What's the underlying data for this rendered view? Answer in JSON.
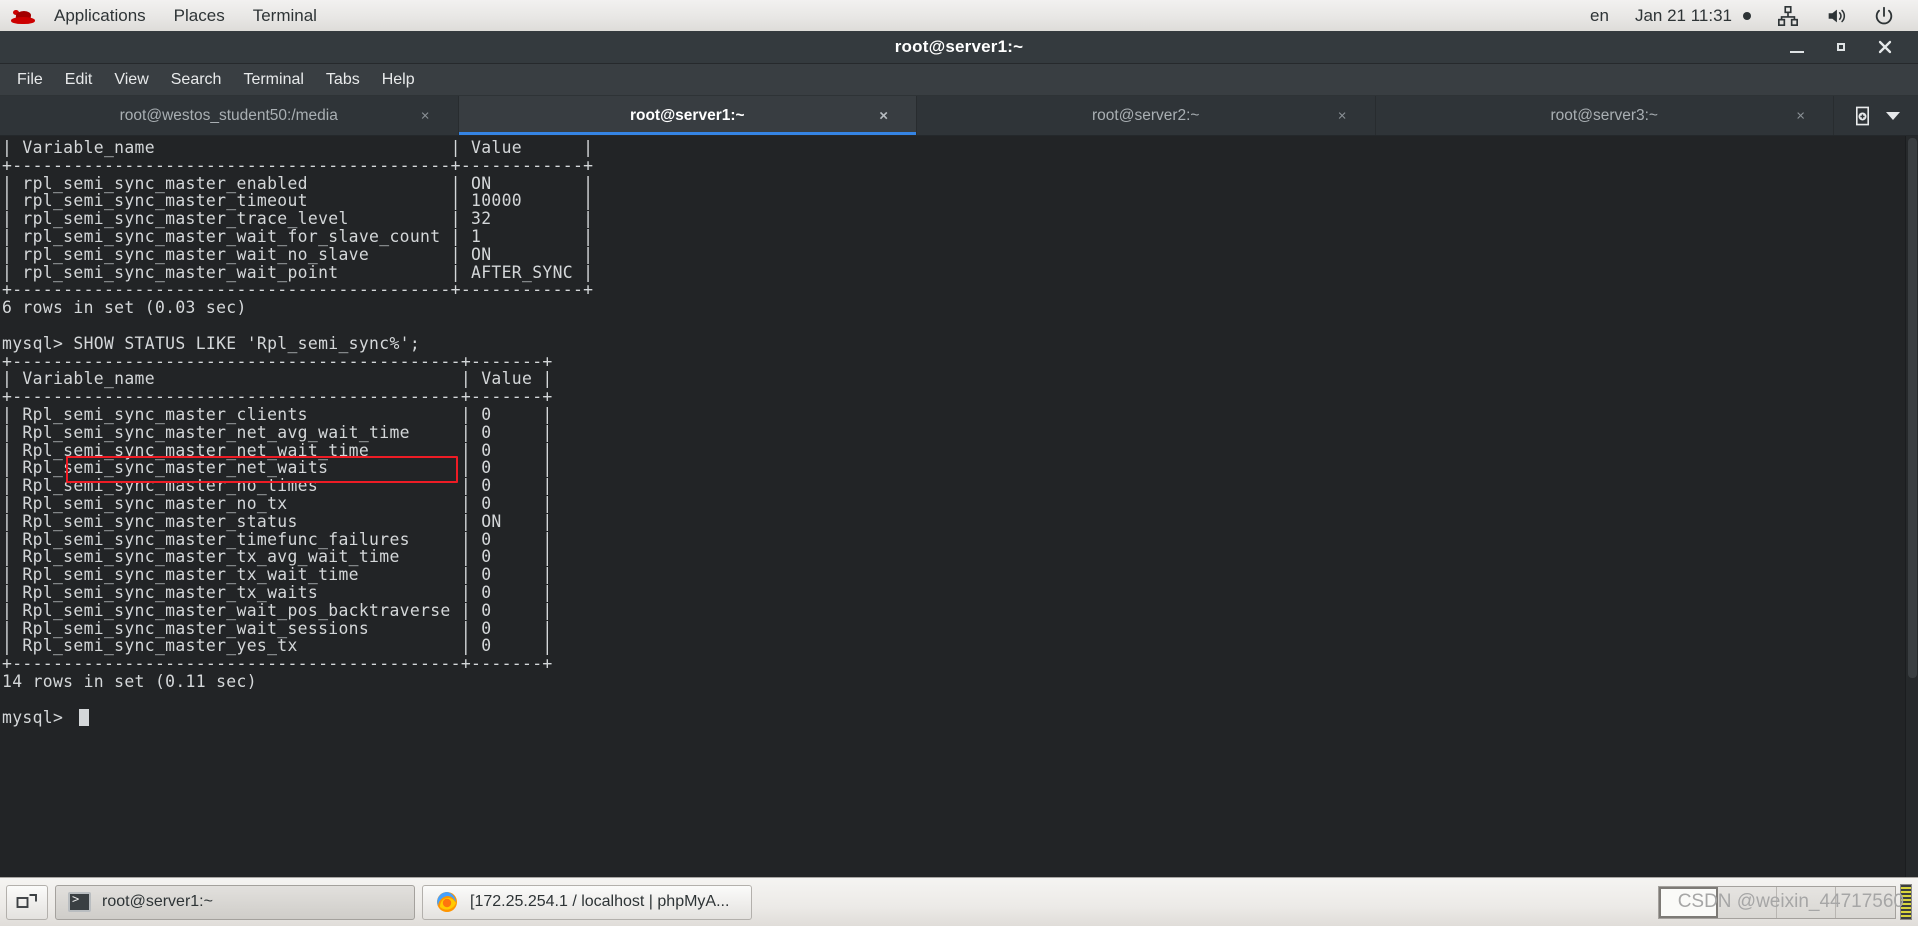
{
  "top_panel": {
    "logo": "redhat-logo",
    "menus": [
      "Applications",
      "Places",
      "Terminal"
    ],
    "language": "en",
    "clock": "Jan 21  11:31",
    "icons": [
      "network-icon",
      "volume-icon",
      "power-icon"
    ]
  },
  "window": {
    "title": "root@server1:~",
    "controls": {
      "minimize": "minimize-button",
      "maximize": "maximize-button",
      "close": "close-button"
    },
    "menu_bar": [
      "File",
      "Edit",
      "View",
      "Search",
      "Terminal",
      "Tabs",
      "Help"
    ],
    "tabs": [
      {
        "label": "root@westos_student50:/media",
        "active": false,
        "close": "×"
      },
      {
        "label": "root@server1:~",
        "active": true,
        "close": "×"
      },
      {
        "label": "root@server2:~",
        "active": false,
        "close": "×"
      },
      {
        "label": "root@server3:~",
        "active": false,
        "close": "×"
      }
    ],
    "tab_tools": {
      "new_tab": "new-tab-icon",
      "tab_menu": "chevron-down-icon"
    }
  },
  "terminal": {
    "prompt": "mysql>",
    "highlighted_command": "SHOW STATUS LIKE 'Rpl_semi_sync%';",
    "first_result_footer": "6 rows in set (0.03 sec)",
    "second_result_footer": "14 rows in set (0.11 sec)",
    "columns": [
      "Variable_name",
      "Value"
    ],
    "variables_table": [
      {
        "name": "rpl_semi_sync_master_enabled",
        "value": "ON"
      },
      {
        "name": "rpl_semi_sync_master_timeout",
        "value": "10000"
      },
      {
        "name": "rpl_semi_sync_master_trace_level",
        "value": "32"
      },
      {
        "name": "rpl_semi_sync_master_wait_for_slave_count",
        "value": "1"
      },
      {
        "name": "rpl_semi_sync_master_wait_no_slave",
        "value": "ON"
      },
      {
        "name": "rpl_semi_sync_master_wait_point",
        "value": "AFTER_SYNC"
      }
    ],
    "status_table": [
      {
        "name": "Rpl_semi_sync_master_clients",
        "value": "0"
      },
      {
        "name": "Rpl_semi_sync_master_net_avg_wait_time",
        "value": "0"
      },
      {
        "name": "Rpl_semi_sync_master_net_wait_time",
        "value": "0"
      },
      {
        "name": "Rpl_semi_sync_master_net_waits",
        "value": "0"
      },
      {
        "name": "Rpl_semi_sync_master_no_times",
        "value": "0"
      },
      {
        "name": "Rpl_semi_sync_master_no_tx",
        "value": "0"
      },
      {
        "name": "Rpl_semi_sync_master_status",
        "value": "ON"
      },
      {
        "name": "Rpl_semi_sync_master_timefunc_failures",
        "value": "0"
      },
      {
        "name": "Rpl_semi_sync_master_tx_avg_wait_time",
        "value": "0"
      },
      {
        "name": "Rpl_semi_sync_master_tx_wait_time",
        "value": "0"
      },
      {
        "name": "Rpl_semi_sync_master_tx_waits",
        "value": "0"
      },
      {
        "name": "Rpl_semi_sync_master_wait_pos_backtraverse",
        "value": "0"
      },
      {
        "name": "Rpl_semi_sync_master_wait_sessions",
        "value": "0"
      },
      {
        "name": "Rpl_semi_sync_master_yes_tx",
        "value": "0"
      }
    ],
    "screen_text": "| Variable_name                             | Value      |\n+-------------------------------------------+------------+\n| rpl_semi_sync_master_enabled              | ON         |\n| rpl_semi_sync_master_timeout              | 10000      |\n| rpl_semi_sync_master_trace_level          | 32         |\n| rpl_semi_sync_master_wait_for_slave_count | 1          |\n| rpl_semi_sync_master_wait_no_slave        | ON         |\n| rpl_semi_sync_master_wait_point           | AFTER_SYNC |\n+-------------------------------------------+------------+\n6 rows in set (0.03 sec)\n\nmysql> SHOW STATUS LIKE 'Rpl_semi_sync%';\n+--------------------------------------------+-------+\n| Variable_name                              | Value |\n+--------------------------------------------+-------+\n| Rpl_semi_sync_master_clients               | 0     |\n| Rpl_semi_sync_master_net_avg_wait_time     | 0     |\n| Rpl_semi_sync_master_net_wait_time         | 0     |\n| Rpl_semi_sync_master_net_waits             | 0     |\n| Rpl_semi_sync_master_no_times              | 0     |\n| Rpl_semi_sync_master_no_tx                 | 0     |\n| Rpl_semi_sync_master_status                | ON    |\n| Rpl_semi_sync_master_timefunc_failures     | 0     |\n| Rpl_semi_sync_master_tx_avg_wait_time      | 0     |\n| Rpl_semi_sync_master_tx_wait_time          | 0     |\n| Rpl_semi_sync_master_tx_waits              | 0     |\n| Rpl_semi_sync_master_wait_pos_backtraverse | 0     |\n| Rpl_semi_sync_master_wait_sessions         | 0     |\n| Rpl_semi_sync_master_yes_tx                | 0     |\n+--------------------------------------------+-------+\n14 rows in set (0.11 sec)\n\nmysql>"
  },
  "taskbar": {
    "show_desktop": "show-desktop-icon",
    "windows": [
      {
        "icon": "terminal-icon",
        "label": "root@server1:~",
        "active": true
      },
      {
        "icon": "firefox-icon",
        "label": "[172.25.254.1 / localhost | phpMyA...",
        "active": false
      }
    ],
    "workspaces": 4,
    "active_workspace": 1,
    "watermark": "CSDN @weixin_44717560"
  },
  "colors": {
    "accent": "#3584e4",
    "highlight_box": "#ee1c25",
    "terminal_bg": "#222426",
    "terminal_fg": "#d4d7d9",
    "panel_bg": "#e8e7e5"
  }
}
